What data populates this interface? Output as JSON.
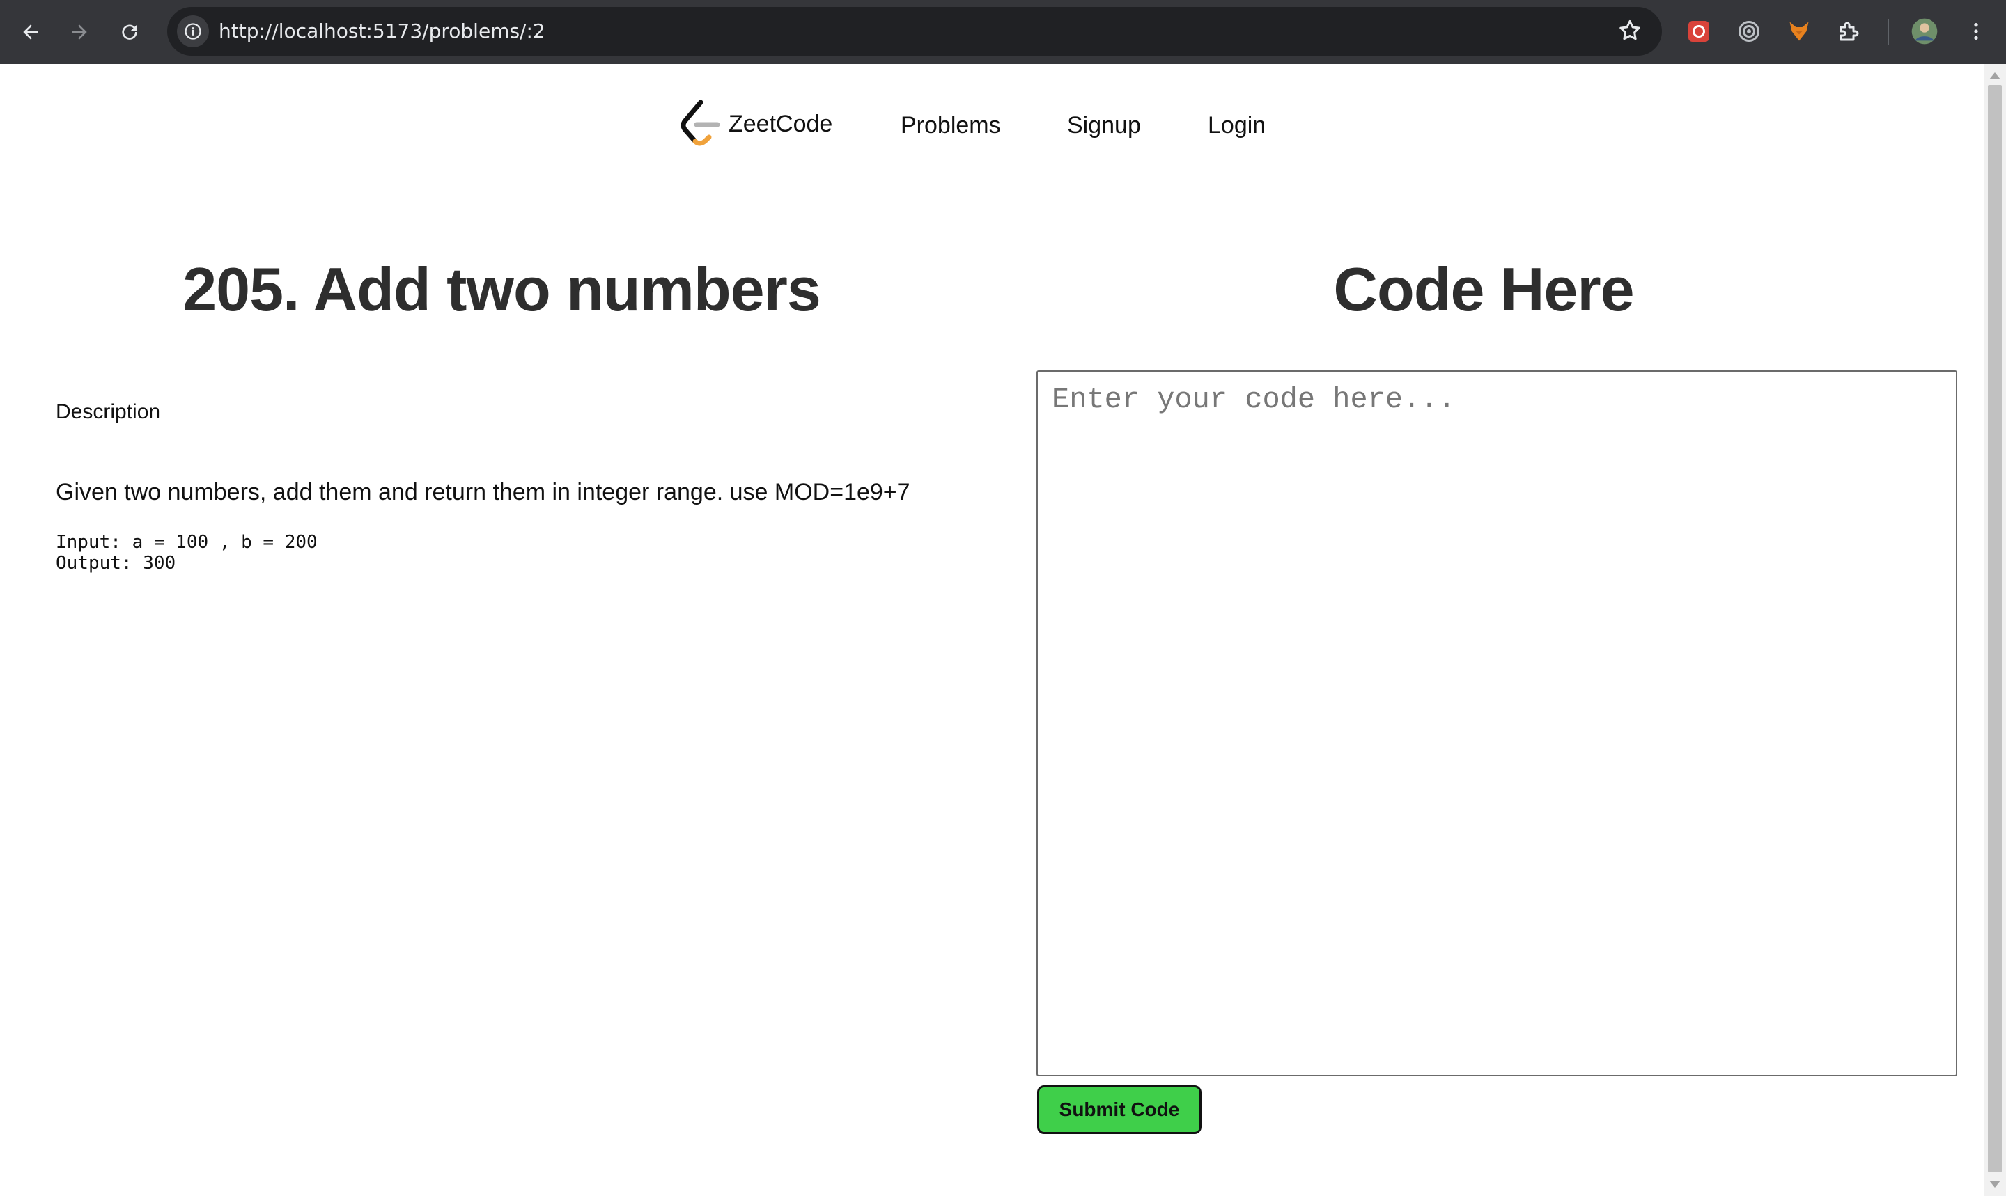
{
  "browser": {
    "url": "http://localhost:5173/problems/:2",
    "icons": [
      "back-icon",
      "forward-icon",
      "reload-icon",
      "site-info-icon",
      "bookmark-star-icon",
      "extension-puzzle-icon",
      "profile-avatar",
      "more-menu-icon"
    ]
  },
  "nav": {
    "brand": "ZeetCode",
    "links": [
      "Problems",
      "Signup",
      "Login"
    ]
  },
  "problem": {
    "title": "205. Add two numbers",
    "description_label": "Description",
    "description": "Given two numbers, add them and return them in integer range. use MOD=1e9+7",
    "example_input": "Input: a = 100 , b = 200",
    "example_output": "Output: 300"
  },
  "editor": {
    "heading": "Code Here",
    "placeholder": "Enter your code here...",
    "submit_label": "Submit Code"
  },
  "colors": {
    "chrome": "#35363a",
    "omnibox": "#202124",
    "submit_button": "#3fcf4a",
    "logo_orange": "#f0a23b"
  }
}
